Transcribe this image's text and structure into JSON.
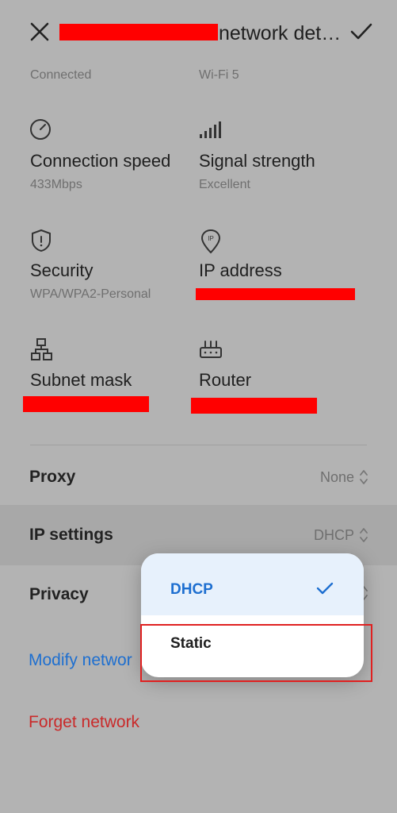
{
  "header": {
    "title": "network det…",
    "close_icon": "close-icon",
    "confirm_icon": "check-icon"
  },
  "info": {
    "status_value": "Connected",
    "wifi_standard_value": "Wi-Fi 5",
    "connection_speed_label": "Connection speed",
    "connection_speed_value": "433Mbps",
    "signal_strength_label": "Signal strength",
    "signal_strength_value": "Excellent",
    "security_label": "Security",
    "security_value": "WPA/WPA2-Personal",
    "ip_address_label": "IP address",
    "subnet_mask_label": "Subnet mask",
    "router_label": "Router"
  },
  "settings": {
    "proxy_label": "Proxy",
    "proxy_value": "None",
    "ip_settings_label": "IP settings",
    "ip_settings_value": "DHCP",
    "privacy_label": "Privacy",
    "modify_network_label": "Modify networ",
    "forget_network_label": "Forget network"
  },
  "dropdown": {
    "options": [
      {
        "label": "DHCP",
        "selected": true
      },
      {
        "label": "Static",
        "selected": false
      }
    ]
  },
  "colors": {
    "accent_blue": "#1e6fd0",
    "danger_red": "#c92a2a",
    "redaction": "#ff0000"
  }
}
